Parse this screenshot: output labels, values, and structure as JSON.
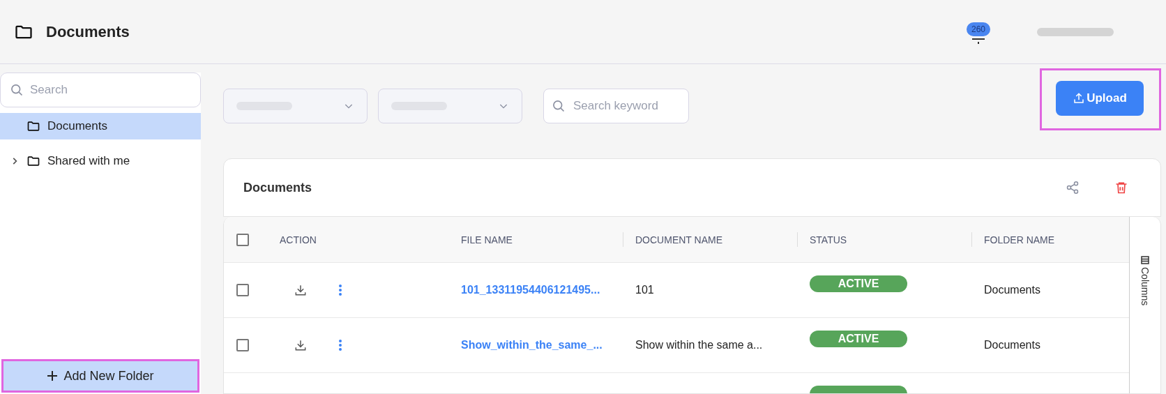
{
  "header": {
    "title": "Documents",
    "notification_count": "260"
  },
  "sidebar": {
    "search": {
      "placeholder": "Search"
    },
    "folders": [
      {
        "label": "Documents",
        "selected": true,
        "has_children": false
      },
      {
        "label": "Shared with me",
        "selected": false,
        "has_children": true
      }
    ],
    "add_button": "Add New Folder"
  },
  "filters": {
    "search": {
      "placeholder": "Search keyword"
    }
  },
  "upload_button": "Upload",
  "table": {
    "title": "Documents",
    "columns_toggle": "Columns",
    "all_selected": false,
    "columns": [
      "ACTION",
      "FILE NAME",
      "DOCUMENT NAME",
      "STATUS",
      "FOLDER NAME"
    ],
    "rows": [
      {
        "checked": false,
        "file_name": "101_13311954406121495...",
        "document_name": "101",
        "status": "ACTIVE",
        "folder_name": "Documents"
      },
      {
        "checked": false,
        "file_name": "Show_within_the_same_...",
        "document_name": "Show within the same a...",
        "status": "ACTIVE",
        "folder_name": "Documents"
      },
      {
        "status_cut": true
      }
    ]
  }
}
